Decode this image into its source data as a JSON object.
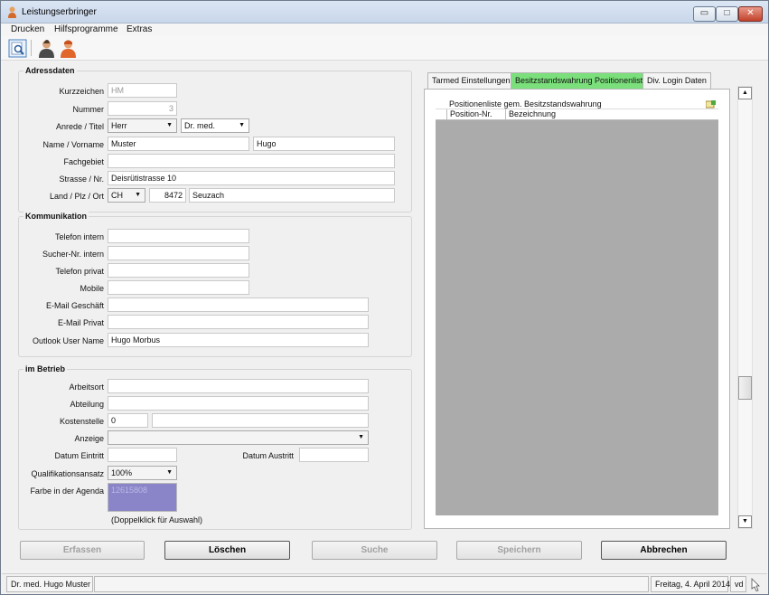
{
  "window": {
    "title": "Leistungserbringer",
    "minimize": "▭",
    "maximize": "□",
    "close": "✕"
  },
  "menu": [
    "Drucken",
    "Hilfsprogramme",
    "Extras"
  ],
  "toolbar": {
    "icons": [
      "search-preview-icon",
      "user-dark-icon",
      "user-orange-icon"
    ]
  },
  "adressdaten": {
    "title": "Adressdaten",
    "kurzzeichen_label": "Kurzzeichen",
    "kurzzeichen": "HM",
    "nummer_label": "Nummer",
    "nummer": "3",
    "anrede_label": "Anrede / Titel",
    "anrede": "Herr",
    "titel": "Dr. med.",
    "name_label": "Name / Vorname",
    "name": "Muster",
    "vorname": "Hugo",
    "fachgebiet_label": "Fachgebiet",
    "fachgebiet": "",
    "strasse_label": "Strasse / Nr.",
    "strasse": "Deisrütistrasse 10",
    "land_label": "Land / Plz / Ort",
    "land": "CH",
    "plz": "8472",
    "ort": "Seuzach"
  },
  "kommunikation": {
    "title": "Kommunikation",
    "tel_intern_label": "Telefon intern",
    "tel_intern": "",
    "sucher_label": "Sucher-Nr. intern",
    "sucher": "",
    "tel_privat_label": "Telefon privat",
    "tel_privat": "",
    "mobile_label": "Mobile",
    "mobile": "",
    "email_gesch_label": "E-Mail Geschäft",
    "email_gesch": "",
    "email_privat_label": "E-Mail Privat",
    "email_privat": "",
    "outlook_label": "Outlook User Name",
    "outlook": "Hugo Morbus"
  },
  "betrieb": {
    "title": "im Betrieb",
    "arbeitsort_label": "Arbeitsort",
    "arbeitsort": "",
    "abteilung_label": "Abteilung",
    "abteilung": "",
    "kostenstelle_label": "Kostenstelle",
    "kostenstelle": "0",
    "kostenstelle_text": "",
    "anzeige_label": "Anzeige",
    "anzeige": "",
    "eintritt_label": "Datum Eintritt",
    "eintritt": "",
    "austritt_label": "Datum Austritt",
    "austritt": "",
    "quali_label": "Qualifikationsansatz",
    "quali": "100%",
    "farbe_label": "Farbe in der Agenda",
    "farbe_value": "12615808",
    "farbe_color": "#8a85c8",
    "farbe_hint": "(Doppelklick für Auswahl)"
  },
  "tabs": [
    {
      "label": "Tarmed Einstellungen",
      "active": false
    },
    {
      "label": "Besitzstandswahrung Positionenliste",
      "active": true
    },
    {
      "label": "Div. Login Daten",
      "active": false
    }
  ],
  "grid": {
    "caption": "Positionenliste gem. Besitzstandswahrung",
    "col1": "Position-Nr.",
    "col2": "Bezeichnung"
  },
  "scroll": {
    "up": "▲",
    "down": "▼"
  },
  "buttons": {
    "erfassen": "Erfassen",
    "loeschen": "Löschen",
    "suche": "Suche",
    "speichern": "Speichern",
    "abbrechen": "Abbrechen"
  },
  "status": {
    "user": "Dr. med. Hugo Muster",
    "date": "Freitag, 4. April 2014",
    "initials": "vd"
  },
  "colors": {
    "active_tab": "#7be07b",
    "grid_body": "#ababab"
  }
}
